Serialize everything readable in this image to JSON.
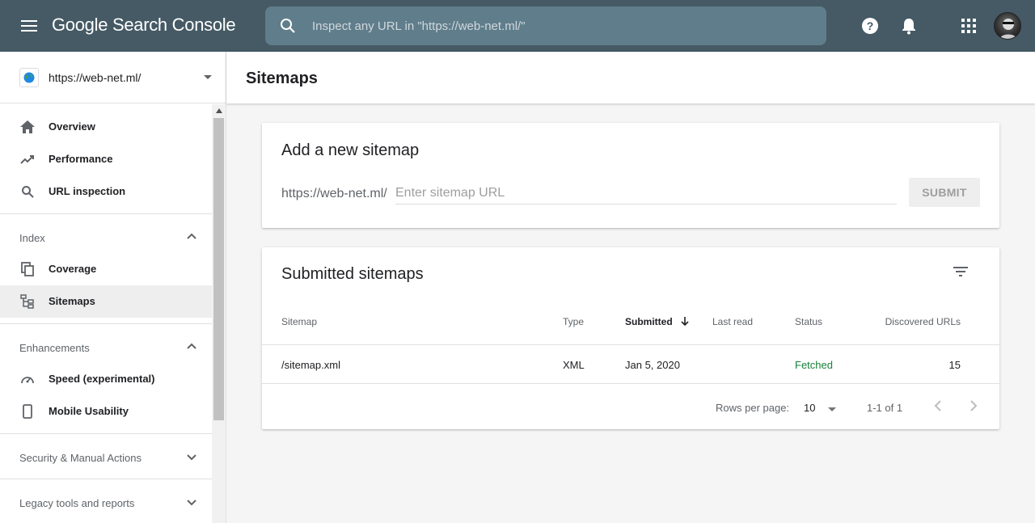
{
  "app": {
    "logo_text": "Google Search Console"
  },
  "search": {
    "placeholder": "Inspect any URL in \"https://web-net.ml/\""
  },
  "property": {
    "url": "https://web-net.ml/"
  },
  "sidebar": {
    "items": [
      {
        "label": "Overview",
        "icon": "home-icon"
      },
      {
        "label": "Performance",
        "icon": "trending-up-icon"
      },
      {
        "label": "URL inspection",
        "icon": "search-icon"
      }
    ],
    "index": {
      "header": "Index",
      "items": [
        {
          "label": "Coverage",
          "icon": "copy-icon"
        },
        {
          "label": "Sitemaps",
          "icon": "sitemap-icon",
          "active": true
        }
      ]
    },
    "enhancements": {
      "header": "Enhancements",
      "items": [
        {
          "label": "Speed (experimental)",
          "icon": "speedometer-icon"
        },
        {
          "label": "Mobile Usability",
          "icon": "smartphone-icon"
        }
      ]
    },
    "security_header": "Security & Manual Actions",
    "legacy_header": "Legacy tools and reports"
  },
  "page": {
    "title": "Sitemaps"
  },
  "add_sitemap": {
    "title": "Add a new sitemap",
    "prefix": "https://web-net.ml/",
    "placeholder": "Enter sitemap URL",
    "submit_label": "SUBMIT"
  },
  "submitted": {
    "title": "Submitted sitemaps",
    "columns": [
      "Sitemap",
      "Type",
      "Submitted",
      "Last read",
      "Status",
      "Discovered URLs"
    ],
    "rows": [
      {
        "sitemap": "/sitemap.xml",
        "type": "XML",
        "submitted": "Jan 5, 2020",
        "last_read": "",
        "status": "Fetched",
        "discovered_urls": "15"
      }
    ],
    "pagination": {
      "rows_per_page_label": "Rows per page:",
      "rows_per_page": "10",
      "range": "1-1 of 1"
    }
  },
  "colors": {
    "topbar": "#455a64",
    "search_bg": "#607d8b",
    "status_fetched": "#188038"
  }
}
